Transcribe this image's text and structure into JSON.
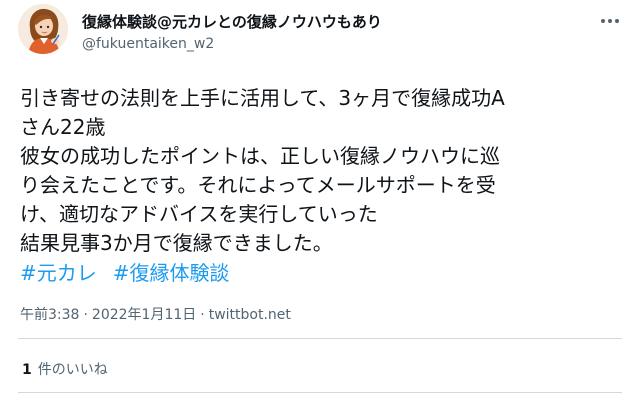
{
  "account": {
    "display_name": "復縁体験談@元カレとの復縁ノウハウもあり",
    "handle": "@fukuentaiken_w2",
    "avatar_icon": "illustrated-woman-avatar-icon"
  },
  "tweet": {
    "lines": [
      "引き寄せの法則を上手に活用して、3ヶ月で復縁成功A",
      "さん22歳",
      "彼女の成功したポイントは、正しい復縁ノウハウに巡",
      "り会えたことです。それによってメールサポートを受",
      "け、適切なアドバイスを実行していった",
      "結果見事3か月で復縁できました。"
    ],
    "hashtags": [
      "#元カレ",
      "#復縁体験談"
    ]
  },
  "meta": {
    "time": "午前3:38",
    "separator1": "·",
    "date": "2022年1月11日",
    "separator2": "·",
    "source": "twittbot.net"
  },
  "engagement": {
    "like_count": "1",
    "like_label": "件のいいね"
  },
  "colors": {
    "text": "#0f1419",
    "secondary": "#536471",
    "link": "#1d9bf0",
    "divider": "#cfd9de"
  }
}
